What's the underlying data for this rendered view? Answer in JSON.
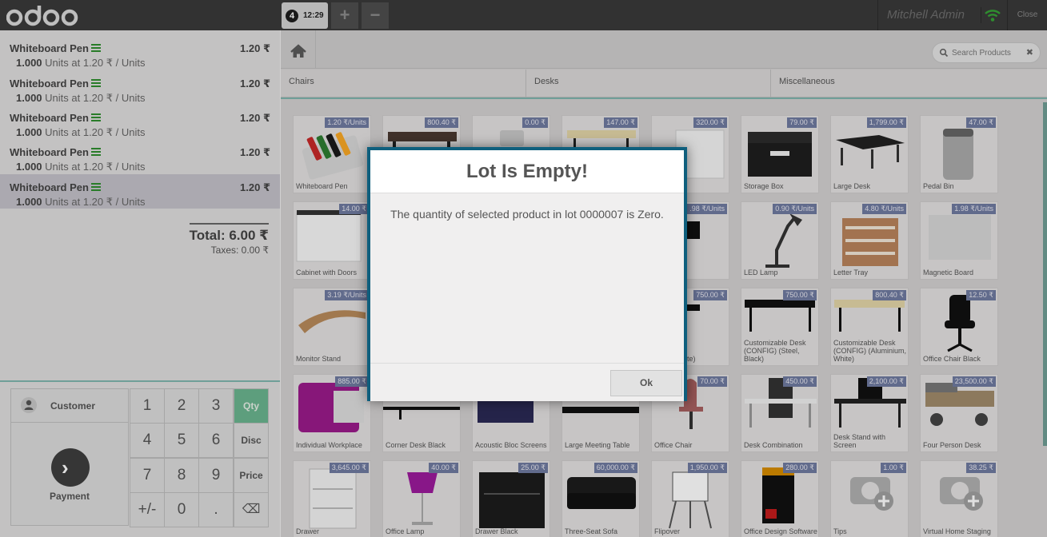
{
  "topbar": {
    "order_number": "4",
    "order_time": "12:29",
    "add_label": "+",
    "remove_label": "−",
    "user": "Mitchell Admin",
    "close_label": "Close"
  },
  "orderlines": [
    {
      "name": "Whiteboard Pen",
      "price": "1.20 ₹",
      "qty": "1.000",
      "info": " Units at 1.20 ₹ / Units"
    },
    {
      "name": "Whiteboard Pen",
      "price": "1.20 ₹",
      "qty": "1.000",
      "info": " Units at 1.20 ₹ / Units"
    },
    {
      "name": "Whiteboard Pen",
      "price": "1.20 ₹",
      "qty": "1.000",
      "info": " Units at 1.20 ₹ / Units"
    },
    {
      "name": "Whiteboard Pen",
      "price": "1.20 ₹",
      "qty": "1.000",
      "info": " Units at 1.20 ₹ / Units"
    },
    {
      "name": "Whiteboard Pen",
      "price": "1.20 ₹",
      "qty": "1.000",
      "info": " Units at 1.20 ₹ / Units"
    }
  ],
  "summary": {
    "total": "Total: 6.00 ₹",
    "taxes": "Taxes: 0.00 ₹"
  },
  "actionpad": {
    "customer": "Customer",
    "payment": "Payment"
  },
  "numpad": {
    "k1": "1",
    "k2": "2",
    "k3": "3",
    "qty": "Qty",
    "k4": "4",
    "k5": "5",
    "k6": "6",
    "disc": "Disc",
    "k7": "7",
    "k8": "8",
    "k9": "9",
    "price": "Price",
    "sign": "+/-",
    "k0": "0",
    "dot": ".",
    "backspace": "⌫"
  },
  "search": {
    "placeholder": "Search Products",
    "clear": "✖"
  },
  "categories": [
    "Chairs",
    "Desks",
    "Miscellaneous"
  ],
  "products": [
    {
      "name": "Whiteboard Pen",
      "price": "1.20 ₹/Units"
    },
    {
      "name": "",
      "price": "800.40 ₹"
    },
    {
      "name": "",
      "price": "0.00 ₹"
    },
    {
      "name": "",
      "price": "147.00 ₹"
    },
    {
      "name": "et",
      "price": "320.00 ₹"
    },
    {
      "name": "Storage Box",
      "price": "79.00 ₹"
    },
    {
      "name": "Large Desk",
      "price": "1,799.00 ₹"
    },
    {
      "name": "Pedal Bin",
      "price": "47.00 ₹"
    },
    {
      "name": "Cabinet with Doors",
      "price": "14.00 ₹"
    },
    {
      "name": "",
      "price": ""
    },
    {
      "name": "",
      "price": ""
    },
    {
      "name": "",
      "price": ""
    },
    {
      "name": "",
      "price": ".98 ₹/Units"
    },
    {
      "name": "LED Lamp",
      "price": "0.90 ₹/Units"
    },
    {
      "name": "Letter Tray",
      "price": "4.80 ₹/Units"
    },
    {
      "name": "Magnetic Board",
      "price": "1.98 ₹/Units"
    },
    {
      "name": "Monitor Stand",
      "price": "3.19 ₹/Units"
    },
    {
      "name": "",
      "price": ""
    },
    {
      "name": "",
      "price": ""
    },
    {
      "name": "",
      "price": ""
    },
    {
      "name": "le Desk\nSteel, White)",
      "price": "750.00 ₹"
    },
    {
      "name": "Customizable Desk\n(CONFIG) (Steel, Black)",
      "price": "750.00 ₹"
    },
    {
      "name": "Customizable Desk\n(CONFIG) (Aluminium,\nWhite)",
      "price": "800.40 ₹"
    },
    {
      "name": "Office Chair Black",
      "price": "12.50 ₹"
    },
    {
      "name": "Individual Workplace",
      "price": "885.00 ₹"
    },
    {
      "name": "Corner Desk Black",
      "price": ""
    },
    {
      "name": "Acoustic Bloc Screens",
      "price": ""
    },
    {
      "name": "Large Meeting Table",
      "price": ""
    },
    {
      "name": "Office Chair",
      "price": "70.00 ₹"
    },
    {
      "name": "Desk Combination",
      "price": "450.00 ₹"
    },
    {
      "name": "Desk Stand with Screen",
      "price": "2,100.00 ₹"
    },
    {
      "name": "Four Person Desk",
      "price": "23,500.00 ₹"
    },
    {
      "name": "Drawer",
      "price": "3,645.00 ₹"
    },
    {
      "name": "Office Lamp",
      "price": "40.00 ₹"
    },
    {
      "name": "Drawer Black",
      "price": "25.00 ₹"
    },
    {
      "name": "Three-Seat Sofa",
      "price": "60,000.00 ₹"
    },
    {
      "name": "Flipover",
      "price": "1,950.00 ₹"
    },
    {
      "name": "Office Design Software",
      "price": "280.00 ₹"
    },
    {
      "name": "Tips",
      "price": "1.00 ₹"
    },
    {
      "name": "Virtual Home Staging",
      "price": "38.25 ₹"
    }
  ],
  "dialog": {
    "title": "Lot Is Empty!",
    "body": "The quantity of selected product in lot 0000007 is Zero.",
    "ok": "Ok"
  }
}
